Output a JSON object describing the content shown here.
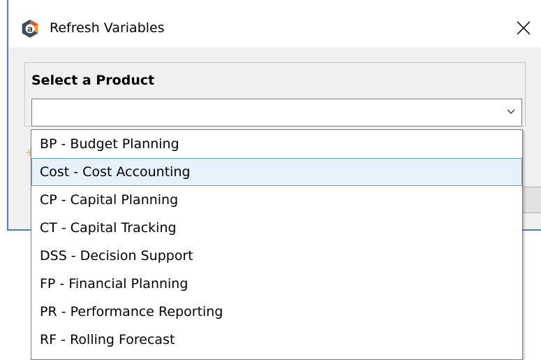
{
  "window": {
    "title": "Refresh Variables",
    "icon": "app-logo-a-icon",
    "close_icon": "close-icon"
  },
  "product_group": {
    "label": "Select a Product",
    "combo_value": "",
    "chevron_icon": "chevron-down-icon"
  },
  "dropdown": {
    "options": [
      {
        "label": "BP - Budget Planning",
        "selected": false
      },
      {
        "label": "Cost - Cost Accounting",
        "selected": true
      },
      {
        "label": "CP - Capital Planning",
        "selected": false
      },
      {
        "label": "CT - Capital Tracking",
        "selected": false
      },
      {
        "label": "DSS - Decision Support",
        "selected": false
      },
      {
        "label": "FP - Financial Planning",
        "selected": false
      },
      {
        "label": "PR - Performance Reporting",
        "selected": false
      },
      {
        "label": "RF - Rolling Forecast",
        "selected": false
      }
    ]
  },
  "colors": {
    "window_border": "#4a7fc1",
    "selection_fill": "#e5f1fb",
    "selection_border": "#4ea3dd",
    "icon_dark": "#3c4b5c",
    "icon_accent": "#e2571e"
  }
}
